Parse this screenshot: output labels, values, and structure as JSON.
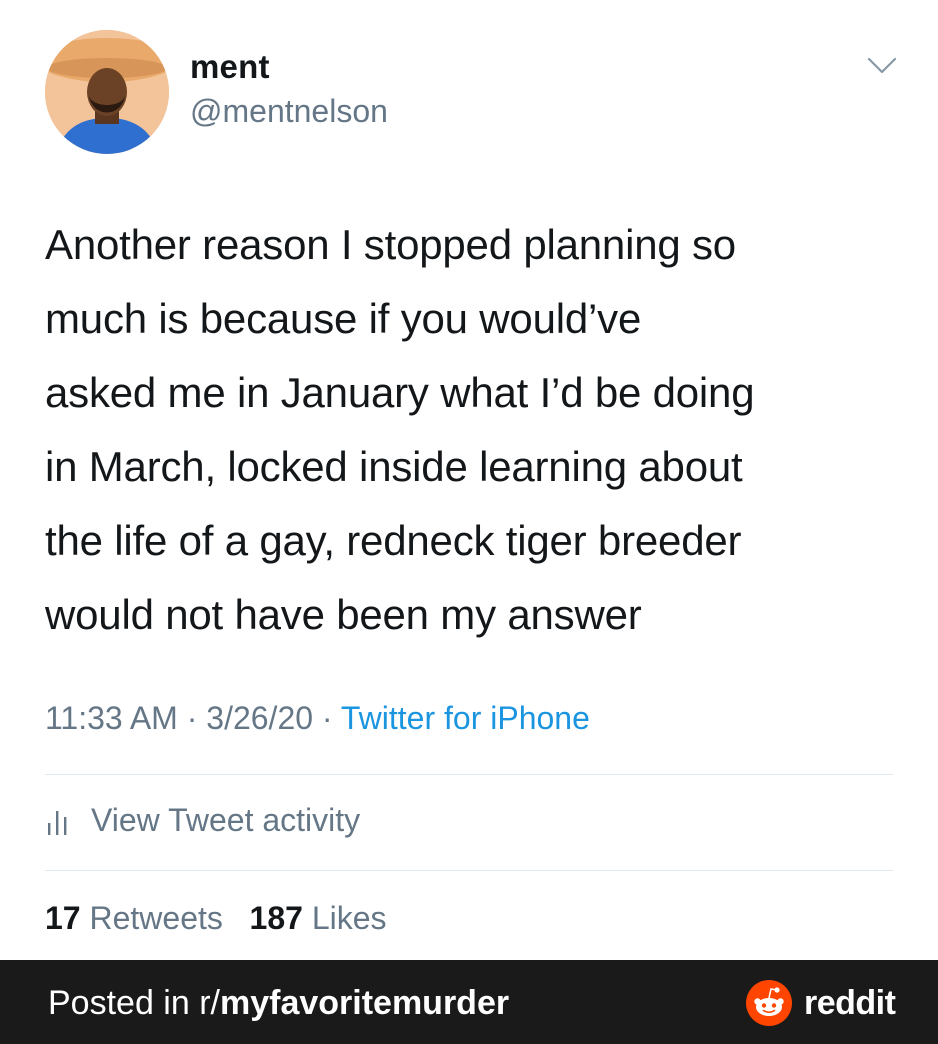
{
  "tweet": {
    "display_name": "ment",
    "handle": "@mentnelson",
    "text_lines": [
      "Another reason I stopped planning so",
      "much is because if you would’ve",
      "asked me in January what I’d be doing",
      "in March, locked inside learning about",
      "the life of a gay, redneck tiger breeder",
      "would not have been my answer"
    ],
    "time": "11:33 AM",
    "date": "3/26/20",
    "separator": "·",
    "source": "Twitter for iPhone",
    "activity_label": "View Tweet activity",
    "retweets_count": "17",
    "retweets_label": "Retweets",
    "likes_count": "187",
    "likes_label": "Likes",
    "icons": {
      "menu": "chevron-down-icon",
      "activity": "bar-chart-icon",
      "avatar": "avatar-image"
    },
    "colors": {
      "text": "#14171a",
      "secondary": "#657786",
      "link": "#1b95e0",
      "divider": "#e1e8ed"
    }
  },
  "footer": {
    "posted_prefix": "Posted in r/",
    "subreddit": "myfavoritemurder",
    "brand": "reddit",
    "icons": {
      "logo": "reddit-logo-icon"
    },
    "colors": {
      "background": "#1a1a1b",
      "brand_orange": "#ff4500"
    }
  }
}
